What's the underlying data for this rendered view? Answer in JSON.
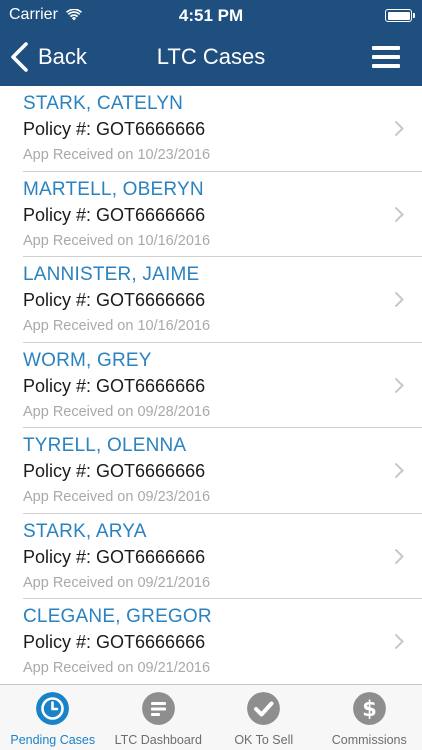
{
  "status_bar": {
    "carrier": "Carrier",
    "time": "4:51 PM"
  },
  "nav": {
    "back_label": "Back",
    "title": "LTC Cases"
  },
  "cases": [
    {
      "name": "STARK, CATELYN",
      "policy": "Policy #: GOT6666666",
      "received": "App Received on 10/23/2016"
    },
    {
      "name": "MARTELL, OBERYN",
      "policy": "Policy #: GOT6666666",
      "received": "App Received on 10/16/2016"
    },
    {
      "name": "LANNISTER, JAIME",
      "policy": "Policy #: GOT6666666",
      "received": "App Received on 10/16/2016"
    },
    {
      "name": "WORM, GREY",
      "policy": "Policy #: GOT6666666",
      "received": "App Received on 09/28/2016"
    },
    {
      "name": "TYRELL, OLENNA",
      "policy": "Policy #: GOT6666666",
      "received": "App Received on 09/23/2016"
    },
    {
      "name": "STARK, ARYA",
      "policy": "Policy #: GOT6666666",
      "received": "App Received on 09/21/2016"
    },
    {
      "name": "CLEGANE, GREGOR",
      "policy": "Policy #: GOT6666666",
      "received": "App Received on 09/21/2016"
    }
  ],
  "tabs": [
    {
      "label": "Pending Cases",
      "icon": "clock-icon",
      "active": true
    },
    {
      "label": "LTC Dashboard",
      "icon": "dashboard-icon",
      "active": false
    },
    {
      "label": "OK To Sell",
      "icon": "checkmark-icon",
      "active": false
    },
    {
      "label": "Commissions",
      "icon": "dollar-icon",
      "active": false
    }
  ],
  "colors": {
    "header_bg": "#1f4f7f",
    "accent": "#1a82c8",
    "name_text": "#2a82c0",
    "tab_inactive": "#8e8e8e"
  }
}
